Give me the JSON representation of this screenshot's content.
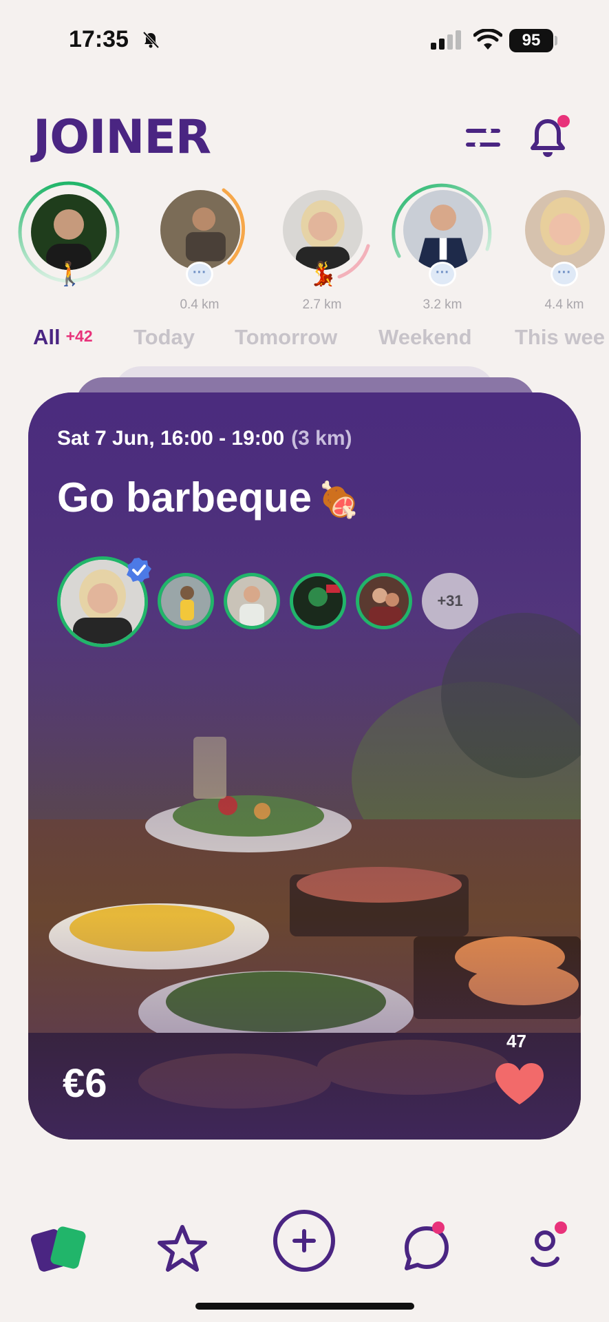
{
  "status_bar": {
    "time": "17:35",
    "battery": "95",
    "icons": [
      "bell-slash-icon",
      "cellular-signal-icon",
      "wifi-icon",
      "battery-icon"
    ]
  },
  "header": {
    "logo": "JOINER",
    "filter_icon": "filter-sliders-icon",
    "notification_icon": "bell-icon",
    "has_notification": true
  },
  "stories": [
    {
      "distance": "",
      "ring": "green",
      "badge": "person-walking-emoji"
    },
    {
      "distance": "0.4 km",
      "ring": "orange",
      "badge": "chat-dots-icon"
    },
    {
      "distance": "2.7 km",
      "ring": "pink",
      "badge": "dancer-emoji"
    },
    {
      "distance": "3.2 km",
      "ring": "green",
      "badge": "chat-dots-icon"
    },
    {
      "distance": "4.4 km",
      "ring": "none",
      "badge": "chat-dots-icon"
    }
  ],
  "tabs": {
    "all_label": "All",
    "all_count": "+42",
    "items": [
      "Today",
      "Tomorrow",
      "Weekend",
      "This wee"
    ]
  },
  "event_card": {
    "date": "Sat 7 Jun, 16:00 - 19:00",
    "distance": "(3 km)",
    "title": "Go barbeque",
    "title_emoji": "🍖",
    "more_attendees": "+31",
    "price": "€6",
    "likes": "47"
  },
  "bottom_nav": {
    "items": [
      "cards-icon",
      "star-icon",
      "add-circle-icon",
      "chat-icon",
      "profile-icon"
    ],
    "active": "cards-icon"
  },
  "colors": {
    "brand": "#4a2582",
    "accent": "#e8327a",
    "green": "#21b56a",
    "heart": "#f26a6a"
  }
}
